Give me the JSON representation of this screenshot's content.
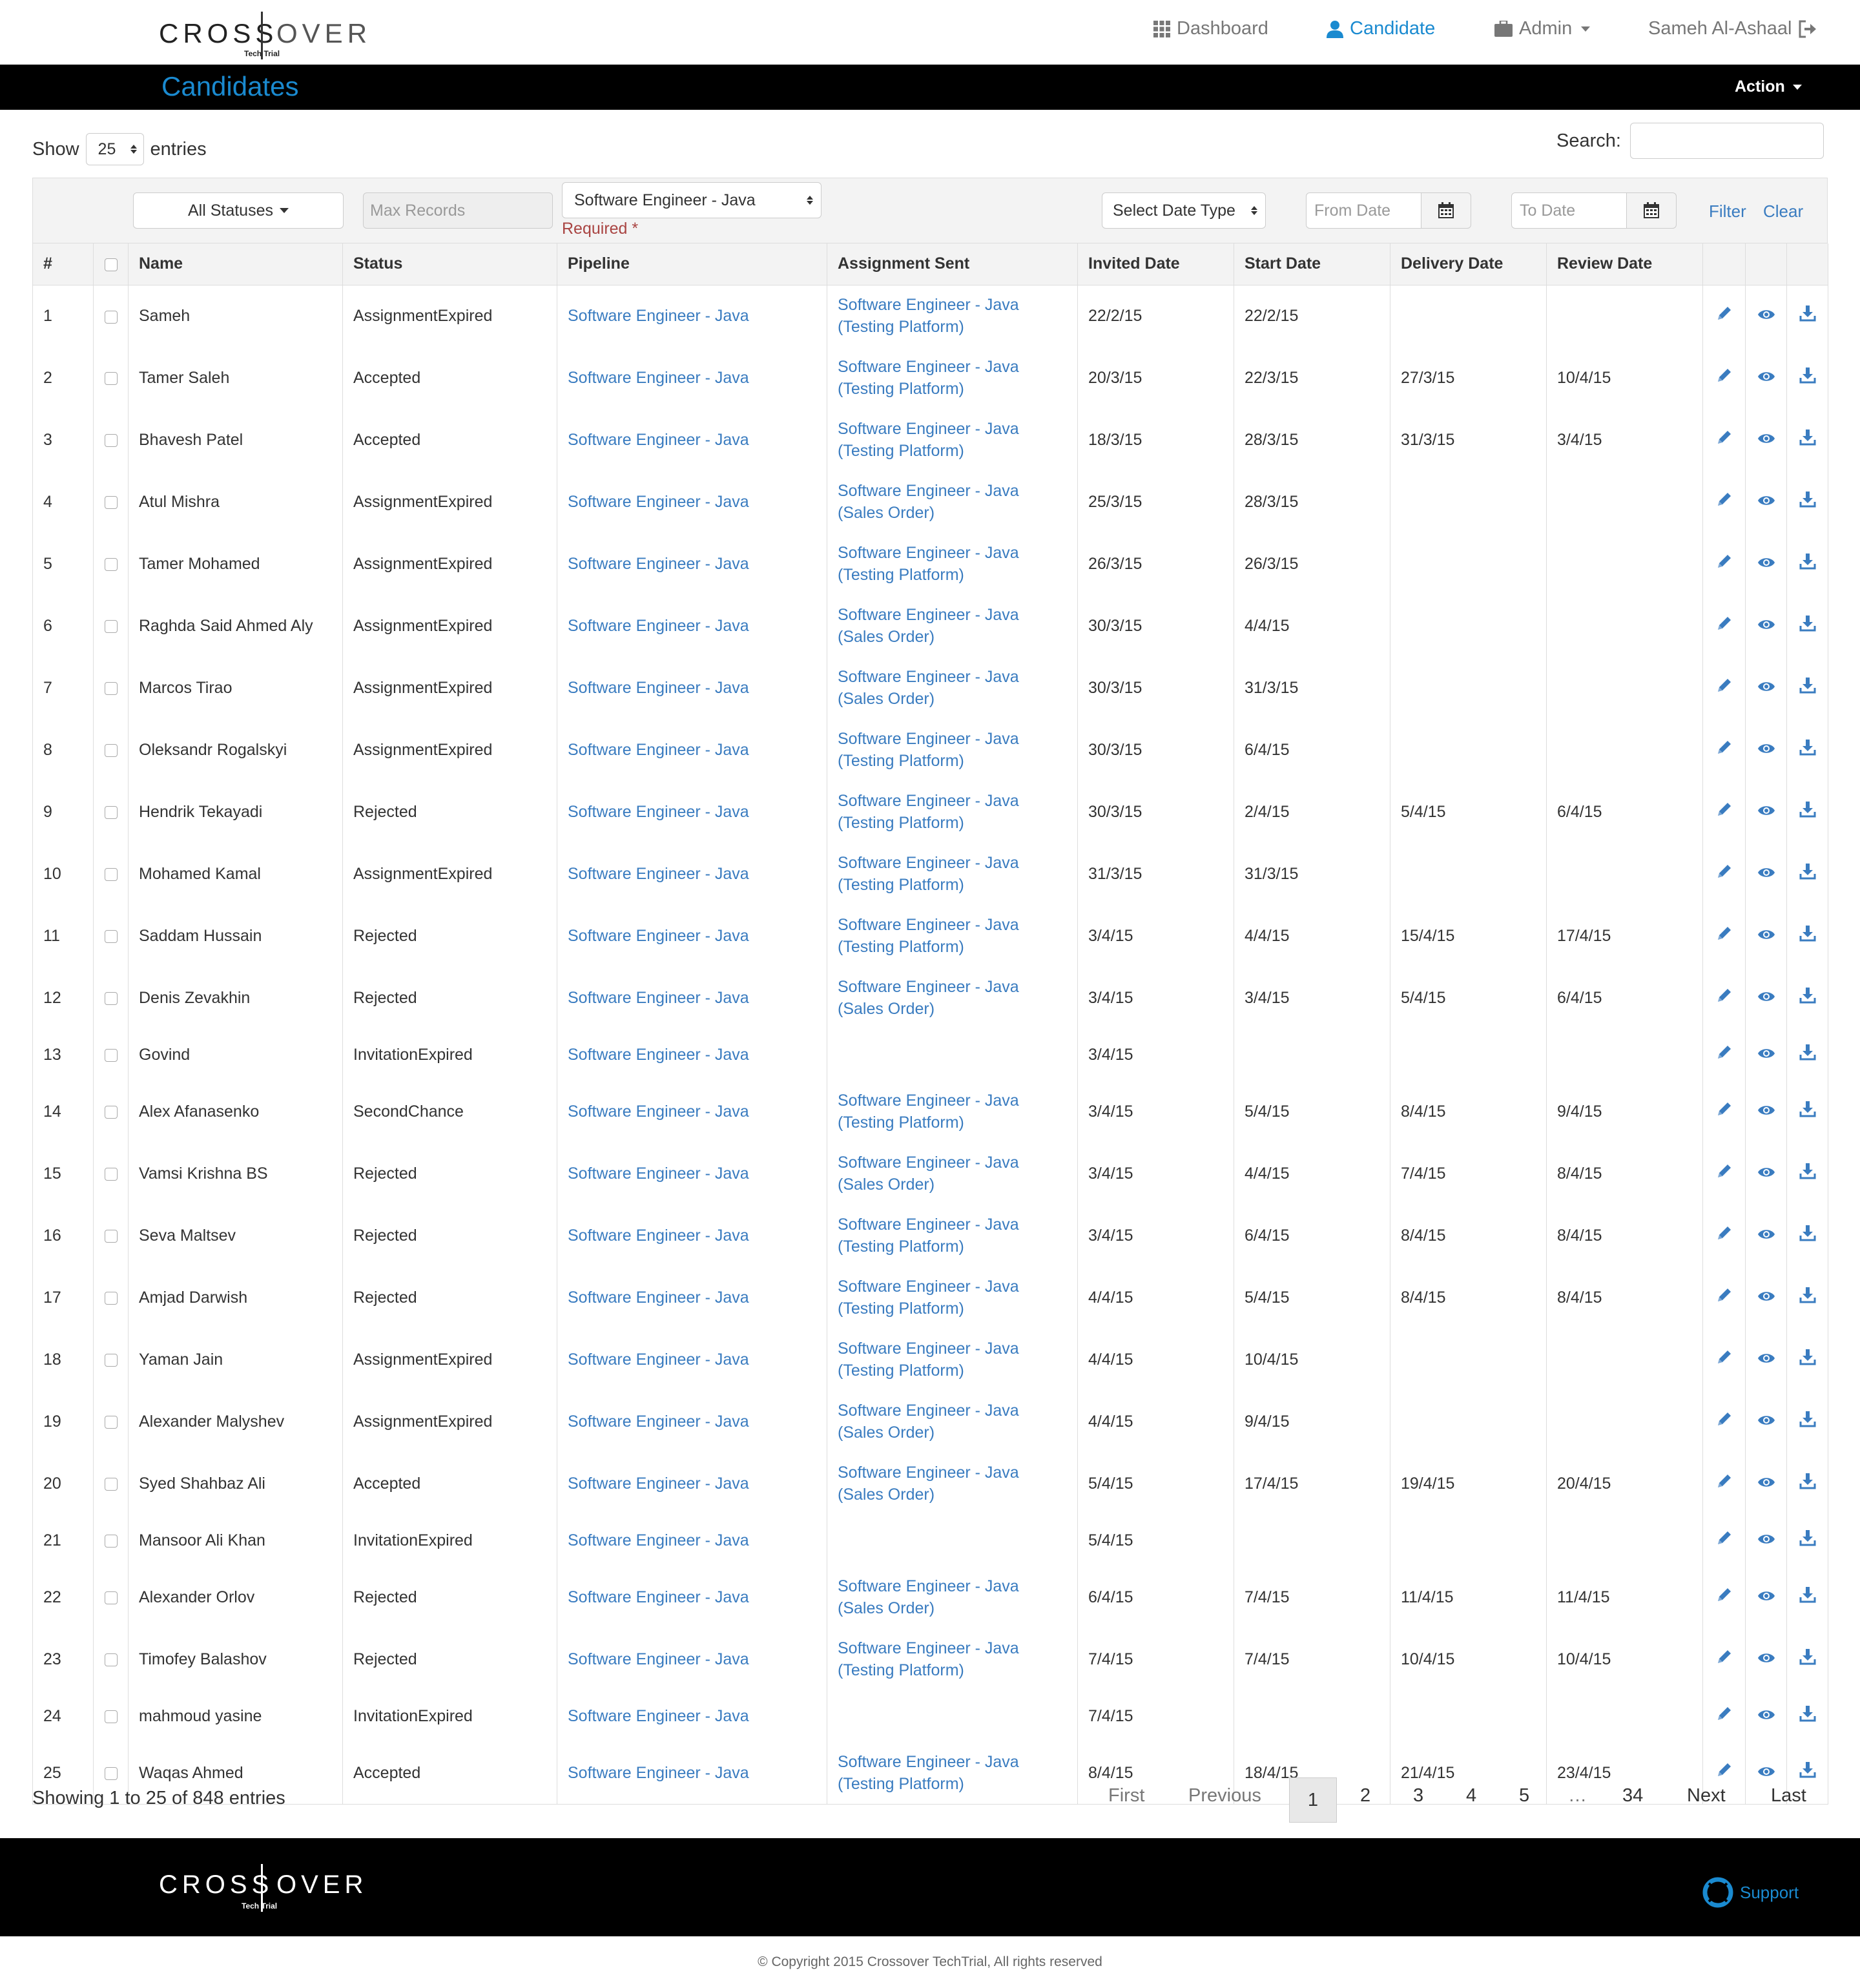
{
  "brand": {
    "cross": "CROSS",
    "over": "OVER",
    "tagline": "Tech Trial"
  },
  "nav": {
    "dashboard": "Dashboard",
    "candidate": "Candidate",
    "admin": "Admin",
    "user": "Sameh Al-Ashaal"
  },
  "page": {
    "title": "Candidates",
    "action": "Action"
  },
  "length": {
    "show": "Show",
    "value": "25",
    "entries": "entries"
  },
  "search": {
    "label": "Search:"
  },
  "filters": {
    "status": "All Statuses",
    "max_records_placeholder": "Max Records",
    "pipeline": "Software Engineer - Java",
    "required": "Required *",
    "date_type": "Select Date Type",
    "from_placeholder": "From Date",
    "to_placeholder": "To Date",
    "filter": "Filter",
    "clear": "Clear"
  },
  "table": {
    "headers": [
      "#",
      "Name",
      "Status",
      "Pipeline",
      "Assignment Sent",
      "Invited Date",
      "Start Date",
      "Delivery Date",
      "Review Date"
    ],
    "rows": [
      {
        "n": "1",
        "name": "Sameh",
        "status": "AssignmentExpired",
        "pipeline": "Software Engineer - Java",
        "a1": "Software Engineer - Java",
        "a2": "(Testing Platform)",
        "invited": "22/2/15",
        "start": "22/2/15",
        "delivery": "",
        "review": ""
      },
      {
        "n": "2",
        "name": "Tamer Saleh",
        "status": "Accepted",
        "pipeline": "Software Engineer - Java",
        "a1": "Software Engineer - Java",
        "a2": "(Testing Platform)",
        "invited": "20/3/15",
        "start": "22/3/15",
        "delivery": "27/3/15",
        "review": "10/4/15"
      },
      {
        "n": "3",
        "name": "Bhavesh Patel",
        "status": "Accepted",
        "pipeline": "Software Engineer - Java",
        "a1": "Software Engineer - Java",
        "a2": "(Testing Platform)",
        "invited": "18/3/15",
        "start": "28/3/15",
        "delivery": "31/3/15",
        "review": "3/4/15"
      },
      {
        "n": "4",
        "name": "Atul Mishra",
        "status": "AssignmentExpired",
        "pipeline": "Software Engineer - Java",
        "a1": "Software Engineer - Java",
        "a2": "(Sales Order)",
        "invited": "25/3/15",
        "start": "28/3/15",
        "delivery": "",
        "review": ""
      },
      {
        "n": "5",
        "name": "Tamer Mohamed",
        "status": "AssignmentExpired",
        "pipeline": "Software Engineer - Java",
        "a1": "Software Engineer - Java",
        "a2": "(Testing Platform)",
        "invited": "26/3/15",
        "start": "26/3/15",
        "delivery": "",
        "review": ""
      },
      {
        "n": "6",
        "name": "Raghda Said Ahmed Aly",
        "status": "AssignmentExpired",
        "pipeline": "Software Engineer - Java",
        "a1": "Software Engineer - Java",
        "a2": "(Sales Order)",
        "invited": "30/3/15",
        "start": "4/4/15",
        "delivery": "",
        "review": ""
      },
      {
        "n": "7",
        "name": "Marcos Tirao",
        "status": "AssignmentExpired",
        "pipeline": "Software Engineer - Java",
        "a1": "Software Engineer - Java",
        "a2": "(Sales Order)",
        "invited": "30/3/15",
        "start": "31/3/15",
        "delivery": "",
        "review": ""
      },
      {
        "n": "8",
        "name": "Oleksandr Rogalskyi",
        "status": "AssignmentExpired",
        "pipeline": "Software Engineer - Java",
        "a1": "Software Engineer - Java",
        "a2": "(Testing Platform)",
        "invited": "30/3/15",
        "start": "6/4/15",
        "delivery": "",
        "review": ""
      },
      {
        "n": "9",
        "name": "Hendrik Tekayadi",
        "status": "Rejected",
        "pipeline": "Software Engineer - Java",
        "a1": "Software Engineer - Java",
        "a2": "(Testing Platform)",
        "invited": "30/3/15",
        "start": "2/4/15",
        "delivery": "5/4/15",
        "review": "6/4/15"
      },
      {
        "n": "10",
        "name": "Mohamed Kamal",
        "status": "AssignmentExpired",
        "pipeline": "Software Engineer - Java",
        "a1": "Software Engineer - Java",
        "a2": "(Testing Platform)",
        "invited": "31/3/15",
        "start": "31/3/15",
        "delivery": "",
        "review": ""
      },
      {
        "n": "11",
        "name": "Saddam Hussain",
        "status": "Rejected",
        "pipeline": "Software Engineer - Java",
        "a1": "Software Engineer - Java",
        "a2": "(Testing Platform)",
        "invited": "3/4/15",
        "start": "4/4/15",
        "delivery": "15/4/15",
        "review": "17/4/15"
      },
      {
        "n": "12",
        "name": "Denis Zevakhin",
        "status": "Rejected",
        "pipeline": "Software Engineer - Java",
        "a1": "Software Engineer - Java",
        "a2": "(Sales Order)",
        "invited": "3/4/15",
        "start": "3/4/15",
        "delivery": "5/4/15",
        "review": "6/4/15"
      },
      {
        "n": "13",
        "name": "Govind",
        "status": "InvitationExpired",
        "pipeline": "Software Engineer - Java",
        "a1": "",
        "a2": "",
        "invited": "3/4/15",
        "start": "",
        "delivery": "",
        "review": ""
      },
      {
        "n": "14",
        "name": "Alex Afanasenko",
        "status": "SecondChance",
        "pipeline": "Software Engineer - Java",
        "a1": "Software Engineer - Java",
        "a2": "(Testing Platform)",
        "invited": "3/4/15",
        "start": "5/4/15",
        "delivery": "8/4/15",
        "review": "9/4/15"
      },
      {
        "n": "15",
        "name": "Vamsi Krishna BS",
        "status": "Rejected",
        "pipeline": "Software Engineer - Java",
        "a1": "Software Engineer - Java",
        "a2": "(Sales Order)",
        "invited": "3/4/15",
        "start": "4/4/15",
        "delivery": "7/4/15",
        "review": "8/4/15"
      },
      {
        "n": "16",
        "name": "Seva Maltsev",
        "status": "Rejected",
        "pipeline": "Software Engineer - Java",
        "a1": "Software Engineer - Java",
        "a2": "(Testing Platform)",
        "invited": "3/4/15",
        "start": "6/4/15",
        "delivery": "8/4/15",
        "review": "8/4/15"
      },
      {
        "n": "17",
        "name": "Amjad Darwish",
        "status": "Rejected",
        "pipeline": "Software Engineer - Java",
        "a1": "Software Engineer - Java",
        "a2": "(Testing Platform)",
        "invited": "4/4/15",
        "start": "5/4/15",
        "delivery": "8/4/15",
        "review": "8/4/15"
      },
      {
        "n": "18",
        "name": "Yaman Jain",
        "status": "AssignmentExpired",
        "pipeline": "Software Engineer - Java",
        "a1": "Software Engineer - Java",
        "a2": "(Testing Platform)",
        "invited": "4/4/15",
        "start": "10/4/15",
        "delivery": "",
        "review": ""
      },
      {
        "n": "19",
        "name": "Alexander Malyshev",
        "status": "AssignmentExpired",
        "pipeline": "Software Engineer - Java",
        "a1": "Software Engineer - Java",
        "a2": "(Sales Order)",
        "invited": "4/4/15",
        "start": "9/4/15",
        "delivery": "",
        "review": ""
      },
      {
        "n": "20",
        "name": "Syed Shahbaz Ali",
        "status": "Accepted",
        "pipeline": "Software Engineer - Java",
        "a1": "Software Engineer - Java",
        "a2": "(Sales Order)",
        "invited": "5/4/15",
        "start": "17/4/15",
        "delivery": "19/4/15",
        "review": "20/4/15"
      },
      {
        "n": "21",
        "name": "Mansoor Ali Khan",
        "status": "InvitationExpired",
        "pipeline": "Software Engineer - Java",
        "a1": "",
        "a2": "",
        "invited": "5/4/15",
        "start": "",
        "delivery": "",
        "review": ""
      },
      {
        "n": "22",
        "name": "Alexander Orlov",
        "status": "Rejected",
        "pipeline": "Software Engineer - Java",
        "a1": "Software Engineer - Java",
        "a2": "(Sales Order)",
        "invited": "6/4/15",
        "start": "7/4/15",
        "delivery": "11/4/15",
        "review": "11/4/15"
      },
      {
        "n": "23",
        "name": "Timofey Balashov",
        "status": "Rejected",
        "pipeline": "Software Engineer - Java",
        "a1": "Software Engineer - Java",
        "a2": "(Testing Platform)",
        "invited": "7/4/15",
        "start": "7/4/15",
        "delivery": "10/4/15",
        "review": "10/4/15"
      },
      {
        "n": "24",
        "name": "mahmoud yasine",
        "status": "InvitationExpired",
        "pipeline": "Software Engineer - Java",
        "a1": "",
        "a2": "",
        "invited": "7/4/15",
        "start": "",
        "delivery": "",
        "review": ""
      },
      {
        "n": "25",
        "name": "Waqas Ahmed",
        "status": "Accepted",
        "pipeline": "Software Engineer - Java",
        "a1": "Software Engineer - Java",
        "a2": "(Testing Platform)",
        "invited": "8/4/15",
        "start": "18/4/15",
        "delivery": "21/4/15",
        "review": "23/4/15"
      }
    ],
    "row_icons": [
      "pencil-icon",
      "eye-icon",
      "download-icon"
    ]
  },
  "footer_info": {
    "showing": "Showing 1 to 25 of 848 entries"
  },
  "pagination": {
    "first": "First",
    "previous": "Previous",
    "pages": [
      "1",
      "2",
      "3",
      "4",
      "5",
      "…",
      "34"
    ],
    "next": "Next",
    "last": "Last"
  },
  "footer": {
    "support": "Support",
    "copyright": "© Copyright 2015 Crossover TechTrial, All rights reserved"
  },
  "colors": {
    "accent": "#1a8ad0",
    "link": "#3a7cc0",
    "required": "#a94442",
    "bar": "#000000"
  }
}
